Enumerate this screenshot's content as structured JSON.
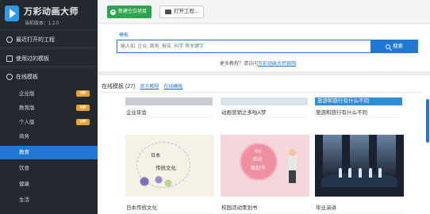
{
  "app": {
    "title": "万彩动画大师",
    "version": "当前版本：1.2.0"
  },
  "sidebar": {
    "recent": "最近打开的工程",
    "used_templates": "使用过的模板",
    "online_templates": "在线模板",
    "items": [
      {
        "label": "企业版",
        "badge": "VIP"
      },
      {
        "label": "教育版",
        "badge": "VIP"
      },
      {
        "label": "个人版",
        "badge": "VIP"
      },
      {
        "label": "商务"
      },
      {
        "label": "教育",
        "active": true
      },
      {
        "label": "饮食"
      },
      {
        "label": "健康"
      },
      {
        "label": "生活"
      }
    ]
  },
  "toolbar": {
    "new_project": "新建空白项目",
    "open_project": "打开工程..."
  },
  "search": {
    "label": "模板",
    "placeholder": "输入如: 企业, 商务, 报告, 科学 等关键字",
    "button": "搜索",
    "help_prefix": "更多教程？请访问",
    "help_link": "万彩动画大师官网"
  },
  "templates": {
    "section_title": "在线模板 (27)",
    "tabs": [
      "官方教程",
      "在线模板"
    ],
    "cards": [
      {
        "caption": "企业年会"
      },
      {
        "caption": "动画营销之多啦A梦"
      },
      {
        "caption": "旅游和旅行有什么不同",
        "thumb_text": "旅游和旅行有什么不同"
      },
      {
        "caption": "日本传统文化",
        "thumb_text_1": "日本",
        "thumb_text_2": "传统文化"
      },
      {
        "caption": "校园活动策划书",
        "thumb_text_1": "校园",
        "thumb_text_2": "活动",
        "thumb_text_3": "策划书"
      },
      {
        "caption": "毕业演讲"
      }
    ]
  },
  "colors": {
    "sidebar_bg": "#24292f",
    "accent": "#1f78d1",
    "new_button": "#2fa44f",
    "vip": "#e5a238"
  }
}
